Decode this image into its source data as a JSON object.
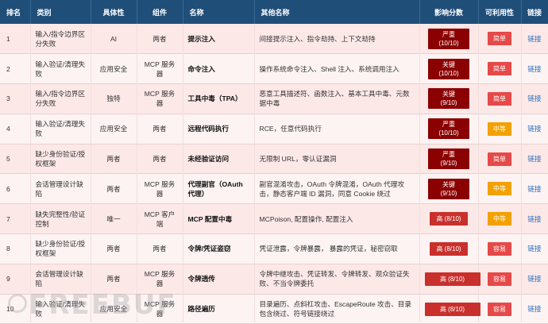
{
  "headers": {
    "rank": "排名",
    "category": "类别",
    "specificity": "具体性",
    "component": "组件",
    "name": "名称",
    "other_names": "其他名称",
    "impact": "影响分数",
    "usability": "可利用性",
    "link": "链接"
  },
  "rows": [
    {
      "rank": "1",
      "category": "输入/指令边界区分失败",
      "specificity": "AI",
      "component": "两者",
      "name": "提示注入",
      "other_names": "间接提示注入、指令劫持、上下文劫持",
      "impact": "严重\n(10/10)",
      "impact_style": "crit",
      "usability": "简单",
      "usability_style": "easy",
      "link": "链接"
    },
    {
      "rank": "2",
      "category": "输入验证/清理失败",
      "specificity": "应用安全",
      "component": "MCP 服务器",
      "name": "命令注入",
      "other_names": "操作系统命令注入、Shell 注入、系统调用注入",
      "impact": "关键\n(10/10)",
      "impact_style": "crit",
      "usability": "简单",
      "usability_style": "easy",
      "link": "链接"
    },
    {
      "rank": "3",
      "category": "输入/指令边界区分失败",
      "specificity": "独特",
      "component": "MCP 服务器",
      "name": "工具中毒（TPA）",
      "other_names": "恶意工具描述符、函数注入、基本工具中毒、元数据中毒",
      "impact": "关键\n(9/10)",
      "impact_style": "crit",
      "usability": "简单",
      "usability_style": "easy",
      "link": "链接"
    },
    {
      "rank": "4",
      "category": "输入验证/清理失败",
      "specificity": "应用安全",
      "component": "两者",
      "name": "远程代码执行",
      "other_names": "RCE，任意代码执行",
      "impact": "严重\n(10/10)",
      "impact_style": "crit",
      "usability": "中等",
      "usability_style": "mid",
      "link": "链接"
    },
    {
      "rank": "5",
      "category": "缺少身份验证/授权框架",
      "specificity": "两者",
      "component": "两者",
      "name": "未经验证访问",
      "other_names": "无限制 URL，零认证漏洞",
      "impact": "严重\n(9/10)",
      "impact_style": "crit",
      "usability": "简单",
      "usability_style": "easy",
      "link": "链接"
    },
    {
      "rank": "6",
      "category": "会话管理设计缺陷",
      "specificity": "两者",
      "component": "MCP 服务器",
      "name": "代理副官（OAuth 代理）",
      "other_names": "副官混淆攻击，OAuth 令牌混淆，OAuth 代理攻击，静态客户端 ID 漏洞，同意 Cookie 绕过",
      "impact": "关键\n(9/10)",
      "impact_style": "crit",
      "usability": "中等",
      "usability_style": "mid",
      "link": "链接"
    },
    {
      "rank": "7",
      "category": "缺失完整性/验证控制",
      "specificity": "唯一",
      "component": "MCP 客户端",
      "name": "MCP 配置中毒",
      "other_names": "MCPoison, 配置操作, 配置注入",
      "impact": "高 (8/10)",
      "impact_style": "high",
      "usability": "中等",
      "usability_style": "mid",
      "link": "链接"
    },
    {
      "rank": "8",
      "category": "缺少身份验证/授权框架",
      "specificity": "两者",
      "component": "两者",
      "name": "令牌/凭证盗窃",
      "other_names": "凭证泄露，令牌暴露， 暴露的凭证，秘密窃取",
      "impact": "高 (8/10)",
      "impact_style": "high",
      "usability": "容易",
      "usability_style": "easy",
      "link": "链接"
    },
    {
      "rank": "9",
      "category": "会话管理设计缺陷",
      "specificity": "两者",
      "component": "MCP 服务器",
      "name": "令牌透传",
      "other_names": "令牌中继攻击、凭证转发、令牌转发、观众验证失败、不当令牌委托",
      "impact": "高 (8/10)",
      "impact_style": "high-wide",
      "usability": "容易",
      "usability_style": "easy",
      "link": "链接"
    },
    {
      "rank": "10",
      "category": "输入验证/清理失败",
      "specificity": "应用安全",
      "component": "MCP 服务器",
      "name": "路径遍历",
      "other_names": "目录遍历、点斜杠攻击、EscapeRoute 攻击、目录包含绕过、符号链接绕过",
      "impact": "高 (8/10)",
      "impact_style": "high-wide",
      "usability": "容易",
      "usability_style": "easy",
      "link": "链接"
    }
  ],
  "watermark": "FREEBUF"
}
